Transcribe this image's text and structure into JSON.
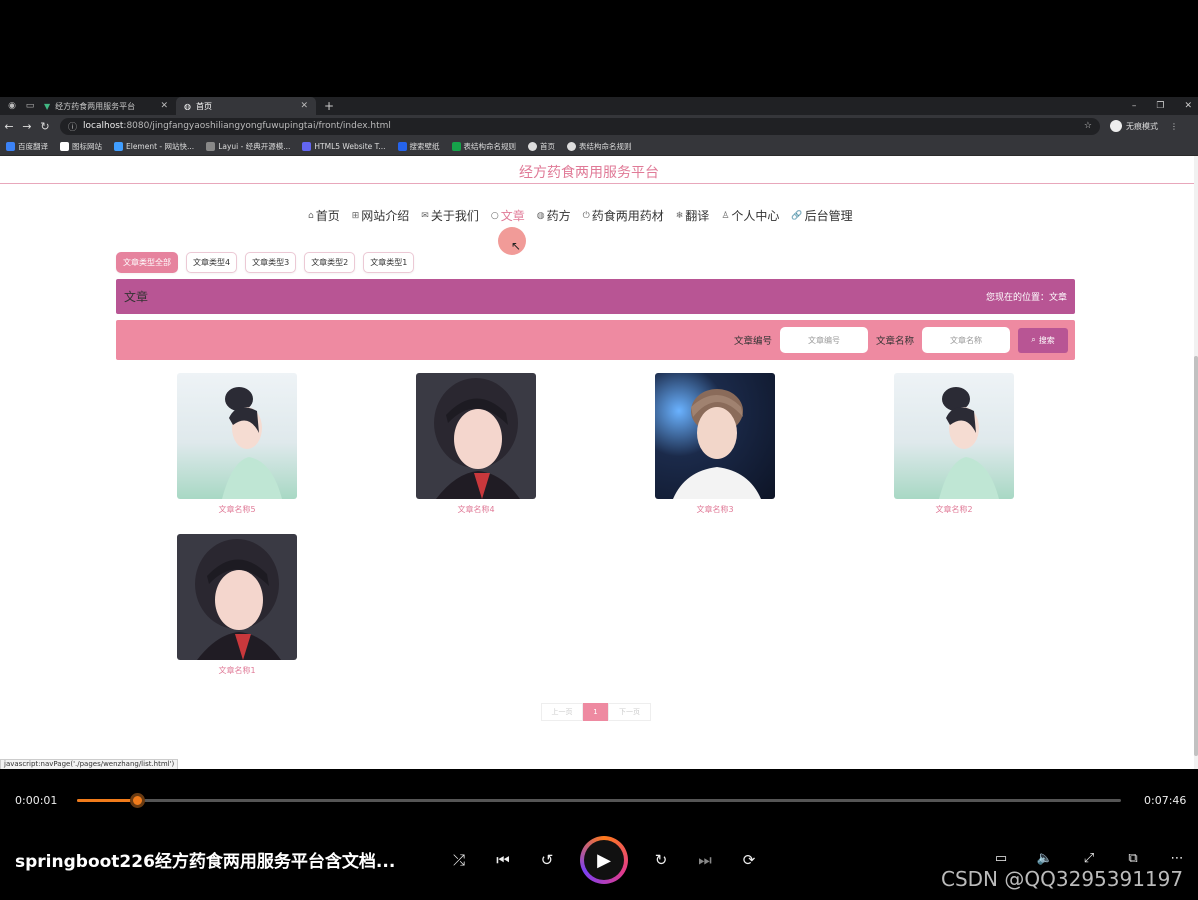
{
  "browser": {
    "tabs": [
      {
        "title": "经方药食两用服务平台",
        "active": false
      },
      {
        "title": "首页",
        "active": true
      }
    ],
    "url_host": "localhost",
    "url_path": ":8080/jingfangyaoshiliangyongfuwupingtai/front/index.html",
    "profile_label": "无痕模式",
    "bookmarks": [
      "百度翻译",
      "图标网站",
      "Element - 网站快...",
      "Layui - 经典开源模...",
      "HTML5 Website T...",
      "搜索壁纸",
      "表结构命名规则",
      "首页",
      "表结构命名规则"
    ]
  },
  "site": {
    "title": "经方药食两用服务平台",
    "nav": [
      {
        "label": "首页",
        "icon": "home-icon",
        "glyph": "⌂"
      },
      {
        "label": "网站介绍",
        "icon": "grid-icon",
        "glyph": "⊞"
      },
      {
        "label": "关于我们",
        "icon": "mail-icon",
        "glyph": "✉"
      },
      {
        "label": "文章",
        "icon": "circle-icon",
        "glyph": "○",
        "active": true
      },
      {
        "label": "药方",
        "icon": "globe-icon",
        "glyph": "◍"
      },
      {
        "label": "药食两用药材",
        "icon": "power-icon",
        "glyph": "⏻"
      },
      {
        "label": "翻译",
        "icon": "snowflake-icon",
        "glyph": "❄"
      },
      {
        "label": "个人中心",
        "icon": "user-icon",
        "glyph": "♙"
      },
      {
        "label": "后台管理",
        "icon": "link-icon",
        "glyph": "🔗"
      }
    ],
    "categories": [
      "文章类型全部",
      "文章类型4",
      "文章类型3",
      "文章类型2",
      "文章类型1"
    ],
    "breadcrumb": {
      "title": "文章",
      "position": "您现在的位置：文章"
    },
    "search": {
      "label_no": "文章编号",
      "placeholder_no": "文章编号",
      "label_name": "文章名称",
      "placeholder_name": "文章名称",
      "button": "搜索"
    },
    "articles": [
      {
        "name": "文章名称5"
      },
      {
        "name": "文章名称4"
      },
      {
        "name": "文章名称3"
      },
      {
        "name": "文章名称2"
      },
      {
        "name": "文章名称1"
      }
    ],
    "pager": {
      "prev": "上一页",
      "current": "1",
      "next": "下一页"
    },
    "status_url": "javascript:navPage('./pages/wenzhang/list.html')"
  },
  "player": {
    "current_time": "0:00:01",
    "total_time": "0:07:46",
    "progress": 0.057,
    "title": "springboot226经方药食两用服务平台含文档...",
    "watermark": "CSDN @QQ3295391197",
    "accent": "#f07b1b"
  }
}
